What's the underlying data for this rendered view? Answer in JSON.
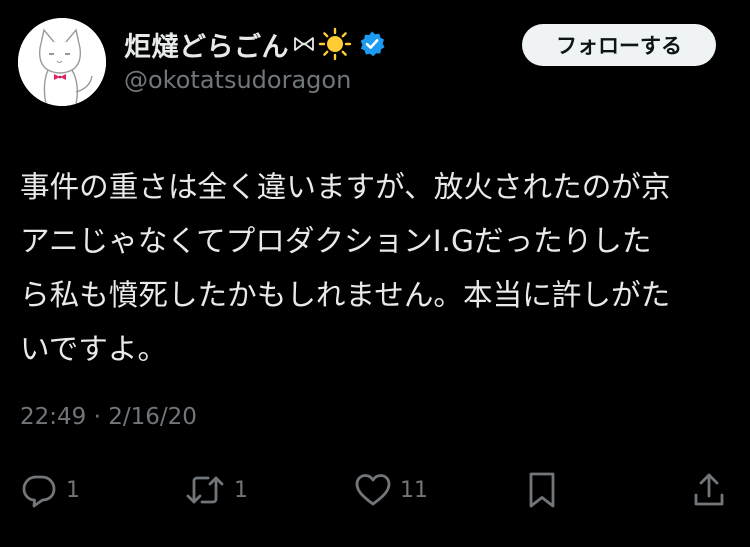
{
  "user": {
    "display_name": "炬燵どらごん",
    "handle": "@okotatsudoragon",
    "name_icons": [
      "bowtie-icon",
      "sun-icon",
      "verified-badge-icon"
    ],
    "avatar": "cat-with-bowtie-avatar"
  },
  "follow_button": {
    "label": "フォローする"
  },
  "tweet": {
    "lines": [
      "事件の重さは全く違いますが、放火されたのが京",
      "アニじゃなくてプロダクションI.Gだったりした",
      "ら私も憤死したかもしれません。本当に許しがた",
      "いですよ。"
    ],
    "timestamp": "22:49 · 2/16/20"
  },
  "actions": {
    "reply": {
      "icon": "reply-icon",
      "count": "1"
    },
    "retweet": {
      "icon": "retweet-icon",
      "count": "1"
    },
    "like": {
      "icon": "heart-icon",
      "count": "11"
    },
    "bookmark": {
      "icon": "bookmark-icon"
    },
    "share": {
      "icon": "share-icon"
    }
  },
  "colors": {
    "background": "#000000",
    "text": "#e7e9ea",
    "secondary": "#71767b",
    "verified": "#1d9bf0",
    "follow_button_bg": "#eff3f4",
    "sun": "#ffcc33",
    "bowtie": "#e0245e"
  }
}
